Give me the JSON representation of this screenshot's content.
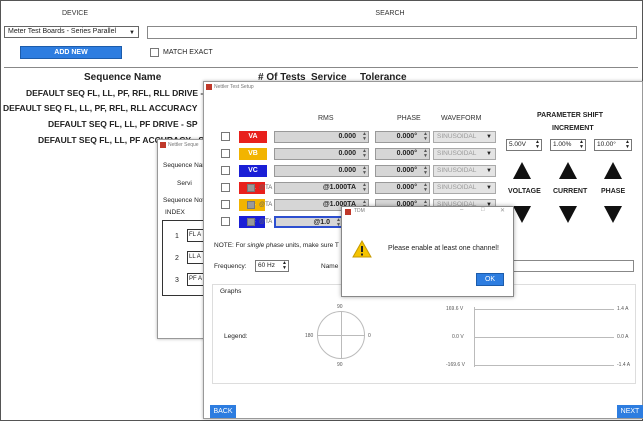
{
  "top": {
    "device_label": "DEVICE",
    "search_label": "SEARCH",
    "device_value": "Meter Test Boards - Series Parallel",
    "add_new": "ADD NEW",
    "match_exact": "MATCH EXACT"
  },
  "sequence_table": {
    "headers": [
      "Sequence Name",
      "# Of Tests",
      "Service",
      "Tolerance"
    ],
    "rows": [
      "DEFAULT SEQ FL, LL, PF, RFL, RLL DRIVE - :",
      "DEFAULT SEQ FL, LL, PF, RFL, RLL ACCURACY",
      "DEFAULT SEQ FL, LL, PF DRIVE - SP",
      "DEFAULT SEQ FL, LL, PF ACCURACY - SP"
    ]
  },
  "bg_window": {
    "title": "Nettler Seque",
    "sequence_name": "Sequence Nam",
    "service": "Servi",
    "sequence_notes": "Sequence Not",
    "index": "INDEX",
    "items": [
      {
        "num": "1",
        "tag": "FL A"
      },
      {
        "num": "2",
        "tag": "LL A"
      },
      {
        "num": "3",
        "tag": "PF A"
      }
    ]
  },
  "test_setup": {
    "title": "Nettler Test Setup",
    "col_rms": "RMS",
    "col_phase": "PHASE",
    "col_waveform": "WAVEFORM",
    "channels": [
      {
        "label": "VA",
        "rms": "0.000",
        "phase": "0.000°",
        "wave": "SINUSOIDAL",
        "ta": "",
        "color": "#e8201c"
      },
      {
        "label": "VB",
        "rms": "0.000",
        "phase": "0.000°",
        "wave": "SINUSOIDAL",
        "ta": "",
        "color": "#f2b400"
      },
      {
        "label": "VC",
        "rms": "0.000",
        "phase": "0.000°",
        "wave": "SINUSOIDAL",
        "ta": "",
        "color": "#1a1fd6"
      },
      {
        "label": "IA",
        "rms": "@1.000TA",
        "phase": "0.000°",
        "wave": "SINUSOIDAL",
        "ta": "@TA",
        "color": "#e8201c"
      },
      {
        "label": "IB",
        "rms": "@1.000TA",
        "phase": "0.000°",
        "wave": "SINUSOIDAL",
        "ta": "@TA",
        "color": "#f2b400"
      },
      {
        "label": "IC",
        "rms": "@1.0",
        "phase": "",
        "wave": "",
        "ta": "@TA",
        "color": "#1a1fd6"
      }
    ],
    "param_shift": "PARAMETER SHIFT",
    "increment": "INCREMENT",
    "inc_values": [
      "5.00V",
      "1.00%",
      "10.00°"
    ],
    "voltage": "VOLTAGE",
    "current": "CURRENT",
    "phase": "PHASE",
    "note_prefix": "NOTE: For ",
    "note_em": "single phase",
    "note_suffix": " units, make sure T",
    "frequency_label": "Frequency:",
    "frequency_value": "60 Hz",
    "name_label": "Name",
    "graphs": "Graphs",
    "legend": "Legend:",
    "polar": {
      "top": "90",
      "left": "180",
      "right": "0",
      "bottom": "90"
    },
    "wave_left": [
      "169.6 V",
      "0.0 V",
      "-169.6 V"
    ],
    "wave_right": [
      "1.4 A",
      "0.0 A",
      "-1.4 A"
    ],
    "back": "BACK",
    "next": "NEXT"
  },
  "dialog": {
    "title": "TDM",
    "message": "Please enable at least one channel!",
    "ok": "OK",
    "controls": [
      "–",
      "□",
      "✕"
    ]
  }
}
